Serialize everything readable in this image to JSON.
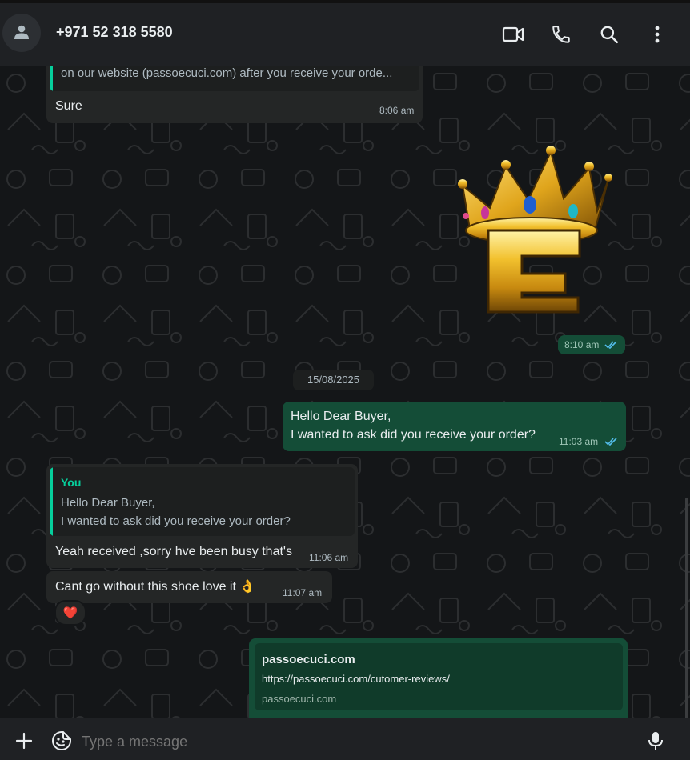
{
  "header": {
    "contact_name": "+971 52 318 5580",
    "icons": [
      "default-avatar-icon",
      "video-call-icon",
      "voice-call-icon",
      "search-icon",
      "menu-kebab-icon"
    ]
  },
  "messages": {
    "m1": {
      "quote_text": "on our website (passoecuci.com) after you receive your orde...",
      "text": "Sure",
      "time": "8:06 am"
    },
    "m2": {
      "sticker": "golden-crown-letter-E-sticker",
      "time": "8:10 am",
      "status": "read"
    },
    "date_divider": "15/08/2025",
    "m3": {
      "line1": "Hello Dear Buyer,",
      "line2": "I wanted to ask did you receive your order?",
      "time": "11:03 am",
      "status": "read"
    },
    "m4": {
      "quote_author": "You",
      "quote_line1": "Hello Dear Buyer,",
      "quote_line2": "I wanted to ask did you receive your order?",
      "text": "Yeah received ,sorry hve been busy that's",
      "time": "11:06 am"
    },
    "m5": {
      "text": "Cant go without this shoe love it 👌",
      "time": "11:07 am",
      "reaction": "❤️"
    },
    "m6": {
      "link_title": "passoecuci.com",
      "link_url": "https://passoecuci.com/cutomer-reviews/",
      "link_domain": "passoecuci.com"
    }
  },
  "composer": {
    "placeholder": "Type a message"
  },
  "colors": {
    "incoming_bubble": "#242626",
    "outgoing_bubble": "#144d37",
    "accent": "#06cf9c",
    "read_ticks": "#53bdeb"
  }
}
